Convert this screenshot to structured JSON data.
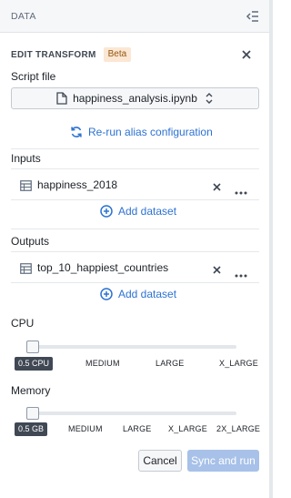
{
  "panel": {
    "title": "DATA"
  },
  "header": {
    "title": "EDIT TRANSFORM",
    "badge": "Beta"
  },
  "script_file": {
    "label": "Script file",
    "value": "happiness_analysis.ipynb"
  },
  "rerun_link": "Re-run alias configuration",
  "inputs": {
    "label": "Inputs",
    "items": [
      {
        "name": "happiness_2018"
      }
    ],
    "add_label": "Add dataset"
  },
  "outputs": {
    "label": "Outputs",
    "items": [
      {
        "name": "top_10_happiest_countries"
      }
    ],
    "add_label": "Add dataset"
  },
  "cpu": {
    "label": "CPU",
    "options": [
      "0.5 CPU",
      "MEDIUM",
      "LARGE",
      "X_LARGE"
    ],
    "selected": "0.5 CPU"
  },
  "memory": {
    "label": "Memory",
    "options": [
      "0.5 GB",
      "MEDIUM",
      "LARGE",
      "X_LARGE",
      "2X_LARGE"
    ],
    "selected": "0.5 GB"
  },
  "footer": {
    "cancel_label": "Cancel",
    "run_label": "Sync and run"
  },
  "colors": {
    "accent": "#2d72d2",
    "run_button_disabled": "#a7c1e8",
    "beta_bg": "#fbe7d3",
    "beta_text": "#935610"
  },
  "icons": {
    "collapse": "collapse-panel-icon",
    "close": "close-icon",
    "file": "document-icon",
    "caret": "caret-up-down-icon",
    "refresh": "refresh-icon",
    "table": "table-icon",
    "remove": "remove-x-icon",
    "more": "more-icon",
    "add": "add-circle-icon"
  }
}
